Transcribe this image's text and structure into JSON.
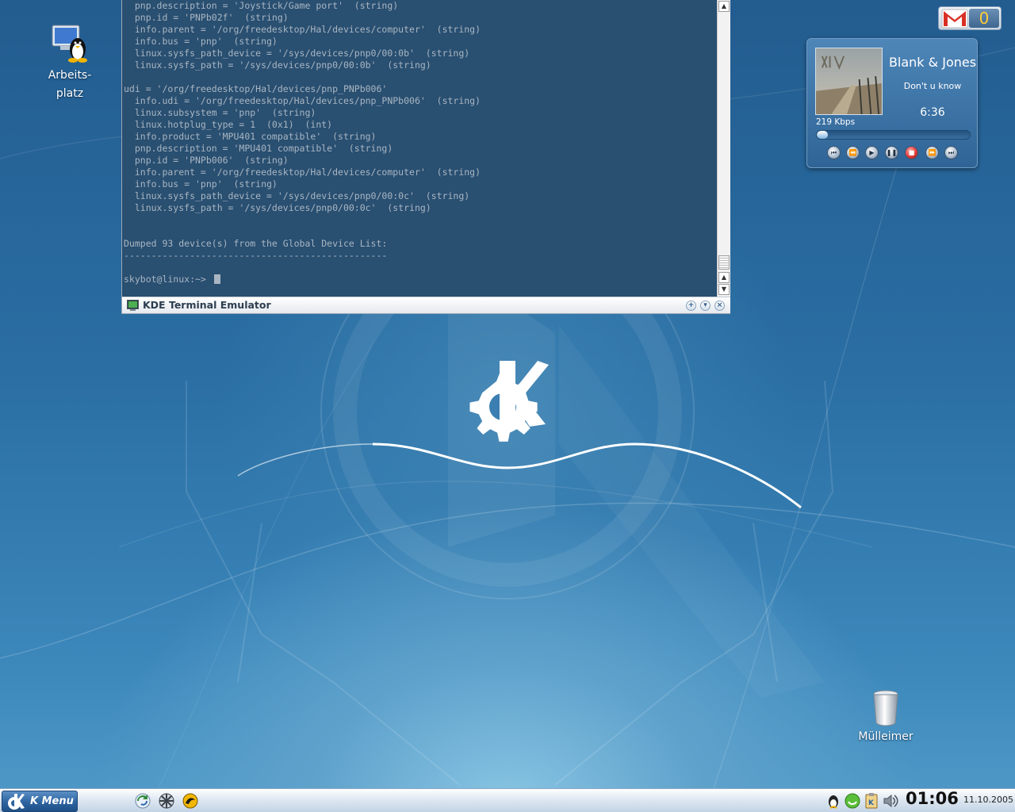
{
  "desktop": {
    "icons": [
      {
        "label": "Arbeits-",
        "label2": "platz"
      },
      {
        "label": "Mülleimer"
      }
    ]
  },
  "terminal": {
    "title": "KDE Terminal Emulator",
    "lines": [
      "  pnp.description = 'Joystick/Game port'  (string)",
      "  pnp.id = 'PNPb02f'  (string)",
      "  info.parent = '/org/freedesktop/Hal/devices/computer'  (string)",
      "  info.bus = 'pnp'  (string)",
      "  linux.sysfs_path_device = '/sys/devices/pnp0/00:0b'  (string)",
      "  linux.sysfs_path = '/sys/devices/pnp0/00:0b'  (string)",
      "",
      "udi = '/org/freedesktop/Hal/devices/pnp_PNPb006'",
      "  info.udi = '/org/freedesktop/Hal/devices/pnp_PNPb006'  (string)",
      "  linux.subsystem = 'pnp'  (string)",
      "  linux.hotplug_type = 1  (0x1)  (int)",
      "  info.product = 'MPU401 compatible'  (string)",
      "  pnp.description = 'MPU401 compatible'  (string)",
      "  pnp.id = 'PNPb006'  (string)",
      "  info.parent = '/org/freedesktop/Hal/devices/computer'  (string)",
      "  info.bus = 'pnp'  (string)",
      "  linux.sysfs_path_device = '/sys/devices/pnp0/00:0c'  (string)",
      "  linux.sysfs_path = '/sys/devices/pnp0/00:0c'  (string)",
      "",
      "",
      "Dumped 93 device(s) from the Global Device List:",
      "------------------------------------------------",
      "",
      "skybot@linux:~> "
    ]
  },
  "gmail": {
    "count": "0"
  },
  "player": {
    "artist": "Blank & Jones",
    "song": "Don't u know",
    "time": "6:36",
    "bitrate": "219 Kbps",
    "progress": 0.07,
    "controls": [
      "skip-back",
      "rewind",
      "play",
      "pause",
      "stop",
      "fast-forward",
      "skip-forward"
    ]
  },
  "taskbar": {
    "kmenu_label": "K Menu",
    "clock": "01:06",
    "date": "11.10.2005"
  },
  "colors": {
    "terminal_bg": "#1c4468",
    "terminal_text": "#a9b6c2",
    "accent": "#2d64a0"
  }
}
